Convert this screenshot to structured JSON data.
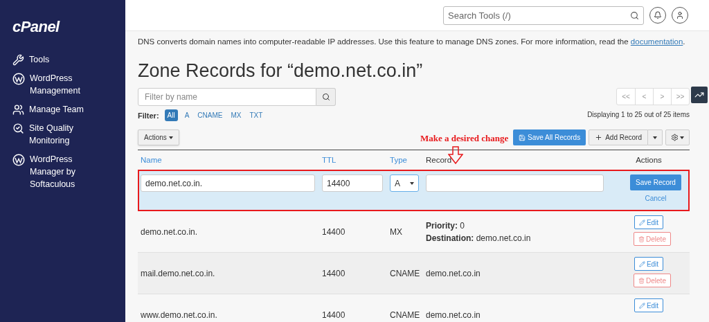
{
  "sidebar": {
    "logo": "cPanel",
    "items": [
      {
        "kind": "tools",
        "label": "Tools"
      },
      {
        "kind": "wordpress",
        "label": "WordPress Management"
      },
      {
        "kind": "team",
        "label": "Manage Team"
      },
      {
        "kind": "quality",
        "label": "Site Quality Monitoring"
      },
      {
        "kind": "wordpress",
        "label": "WordPress Manager by Softaculous"
      }
    ]
  },
  "topbar": {
    "search": {
      "placeholder": "Search Tools (/)"
    }
  },
  "intro": {
    "text": "DNS converts domain names into computer-readable IP addresses. Use this feature to manage DNS zones. For more information, read the ",
    "link": "documentation",
    "end": "."
  },
  "title": "Zone Records for “demo.net.co.in”",
  "filter_field": {
    "placeholder": "Filter by name"
  },
  "filter": {
    "label": "Filter:",
    "options": [
      {
        "label": "All",
        "selected": true
      },
      {
        "label": "A",
        "selected": false
      },
      {
        "label": "CNAME",
        "selected": false
      },
      {
        "label": "MX",
        "selected": false
      },
      {
        "label": "TXT",
        "selected": false
      }
    ]
  },
  "pagination": {
    "buttons": [
      "<<",
      "<",
      ">",
      ">>"
    ],
    "summary": "Displaying 1 to 25 out of 25 items"
  },
  "toolbar": {
    "actions": "Actions",
    "save_all": "Save All Records",
    "add": "Add Record"
  },
  "annotation": "Make a desired change",
  "table": {
    "columns": [
      {
        "label": "Name",
        "sortable": true
      },
      {
        "label": "TTL",
        "sortable": true
      },
      {
        "label": "Type",
        "sortable": true
      },
      {
        "label": "Record",
        "sortable": false
      },
      {
        "label": "Actions",
        "sortable": false
      }
    ],
    "edit_row": {
      "name": "demo.net.co.in.",
      "ttl": "14400",
      "type": "A",
      "save": "Save Record",
      "cancel": "Cancel"
    },
    "rows": [
      {
        "name": "demo.net.co.in.",
        "ttl": "14400",
        "type": "MX",
        "record": [
          {
            "label": "Priority:",
            "value": "0"
          },
          {
            "label": "Destination:",
            "value": "demo.net.co.in"
          }
        ],
        "actions": [
          "Edit",
          "Delete"
        ]
      },
      {
        "name": "mail.demo.net.co.in.",
        "ttl": "14400",
        "type": "CNAME",
        "record": [
          {
            "value": "demo.net.co.in"
          }
        ],
        "actions": [
          "Edit",
          "Delete"
        ]
      },
      {
        "name": "www.demo.net.co.in.",
        "ttl": "14400",
        "type": "CNAME",
        "record": [
          {
            "value": "demo.net.co.in"
          }
        ],
        "actions": [
          "Edit"
        ]
      }
    ]
  }
}
